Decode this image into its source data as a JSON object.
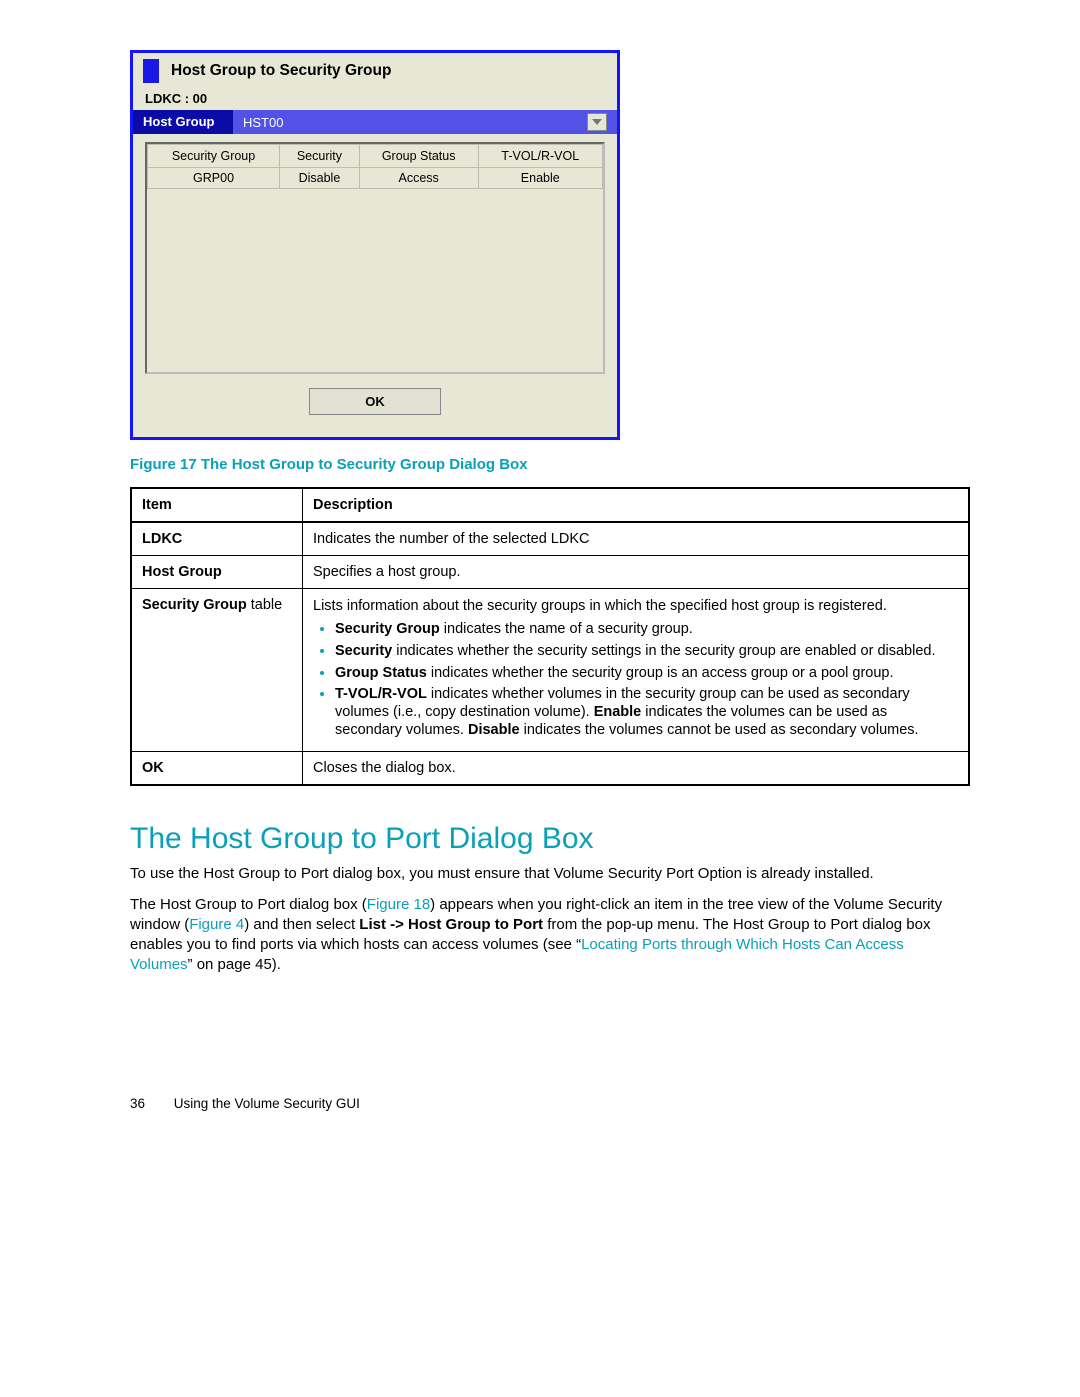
{
  "dialog": {
    "title": "Host Group to Security Group",
    "ldkc_label": "LDKC : 00",
    "host_label": "Host Group",
    "host_value": "HST00",
    "columns": {
      "c0": "Security Group",
      "c1": "Security",
      "c2": "Group Status",
      "c3": "T-VOL/R-VOL"
    },
    "row": {
      "c0": "GRP00",
      "c1": "Disable",
      "c2": "Access",
      "c3": "Enable"
    },
    "ok_label": "OK"
  },
  "fig_caption": "Figure 17 The Host Group to Security Group Dialog Box",
  "desc": {
    "head_item": "Item",
    "head_desc": "Description",
    "ldkc_item": "LDKC",
    "ldkc_desc": "Indicates the number of the selected LDKC",
    "hg_item": "Host Group",
    "hg_desc": "Specifies a host group.",
    "sg_item_1": "Security Group",
    "sg_item_2": " table",
    "sg_intro": "Lists information about the security groups in which the specified host group is registered.",
    "sg_b1_b": "Security Group",
    "sg_b1_r": " indicates the name of a security group.",
    "sg_b2_b": "Security",
    "sg_b2_r": " indicates whether the security settings in the security group are enabled or disabled.",
    "sg_b3_b": "Group Status",
    "sg_b3_r": " indicates whether the security group is an access group or a pool group.",
    "sg_b4_b": "T-VOL/R-VOL",
    "sg_b4_r1": " indicates whether volumes in the security group can be used as secondary volumes (i.e., copy destination volume). ",
    "sg_b4_en": "Enable",
    "sg_b4_r2": " indicates the volumes can be used as secondary volumes. ",
    "sg_b4_di": "Disable",
    "sg_b4_r3": " indicates the volumes cannot be used as secondary volumes.",
    "ok_item": "OK",
    "ok_desc": "Closes the dialog box."
  },
  "section_title": "The Host Group to Port Dialog Box",
  "p1": "To use the Host Group to Port dialog box, you must ensure that Volume Security Port Option is already installed.",
  "p2a": "The Host Group to Port dialog box (",
  "p2_fig18": "Figure 18",
  "p2b": ") appears when you right-click an item in the tree view of the Volume Security window (",
  "p2_fig4": "Figure 4",
  "p2c": ") and then select ",
  "p2_menu": "List -> Host Group to Port",
  "p2d": " from the pop-up menu. The Host Group to Port dialog box enables you to find ports via which hosts can access volumes (see ",
  "p2_quote_open": "“",
  "p2_link": "Locating Ports through Which Hosts Can Access Volumes",
  "p2_quote_close": "” on page 45).",
  "footer": {
    "page_num": "36",
    "chapter": "Using the Volume Security GUI"
  }
}
